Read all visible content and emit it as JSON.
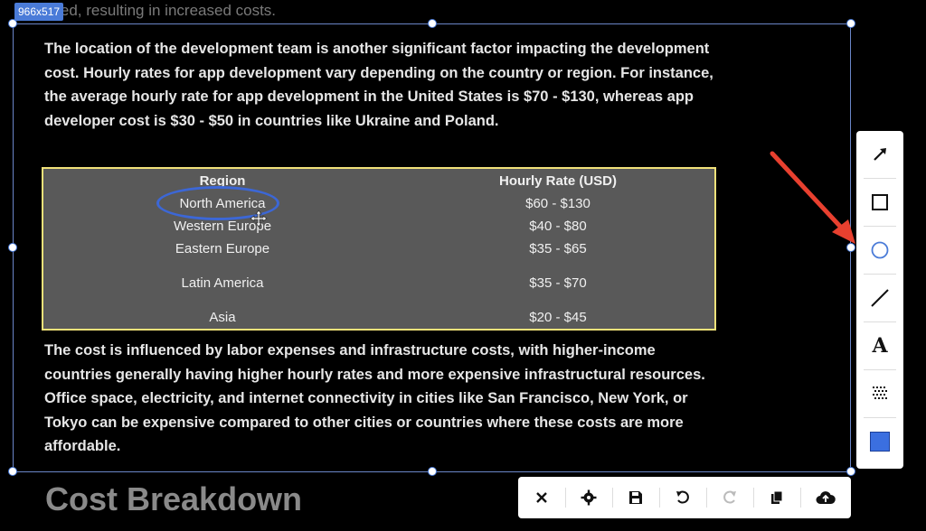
{
  "header": {
    "partial_text": "uired, resulting in increased costs.",
    "selection_size": "966x517"
  },
  "content": {
    "para1": "The location of the development team is another significant factor impacting the development cost. Hourly rates for app development vary depending on the country or region. For instance, the average hourly rate for app development in the United States is $70 - $130, whereas app developer cost is $30 - $50 in countries like Ukraine and Poland.",
    "table": {
      "headers": [
        "Region",
        "Hourly Rate (USD)"
      ],
      "rows": [
        [
          "North America",
          "$60 - $130"
        ],
        [
          "Western Europe",
          "$40 - $80"
        ],
        [
          "Eastern Europe",
          "$35 - $65"
        ],
        [
          "Latin America",
          "$35 - $70"
        ],
        [
          "Asia",
          "$20 - $45"
        ]
      ]
    },
    "para2": "The cost is influenced by labor expenses and infrastructure costs, with higher-income countries generally having higher hourly rates and more expensive infrastructural resources. Office space, electricity, and internet connectivity in cities like San Francisco, New York, or Tokyo can be expensive compared to other cities or countries where these costs are more affordable.",
    "section_title": "Cost Breakdown"
  },
  "tools_vertical": [
    {
      "icon": "arrow-icon"
    },
    {
      "icon": "rectangle-icon"
    },
    {
      "icon": "ellipse-icon"
    },
    {
      "icon": "line-icon"
    },
    {
      "icon": "text-icon",
      "glyph": "A"
    },
    {
      "icon": "blur-icon"
    },
    {
      "icon": "color-swatch-icon",
      "color": "#3b6fe0"
    }
  ],
  "tools_horizontal": [
    {
      "icon": "close-icon"
    },
    {
      "icon": "settings-icon"
    },
    {
      "icon": "save-icon"
    },
    {
      "icon": "undo-icon"
    },
    {
      "icon": "redo-icon"
    },
    {
      "icon": "copy-icon"
    },
    {
      "icon": "upload-icon"
    }
  ],
  "colors": {
    "selection": "#4a7bd8",
    "annotation_circle": "#3c67d6",
    "arrow": "#e8402f",
    "table_border": "#f2e27a",
    "table_bg": "#595959"
  }
}
